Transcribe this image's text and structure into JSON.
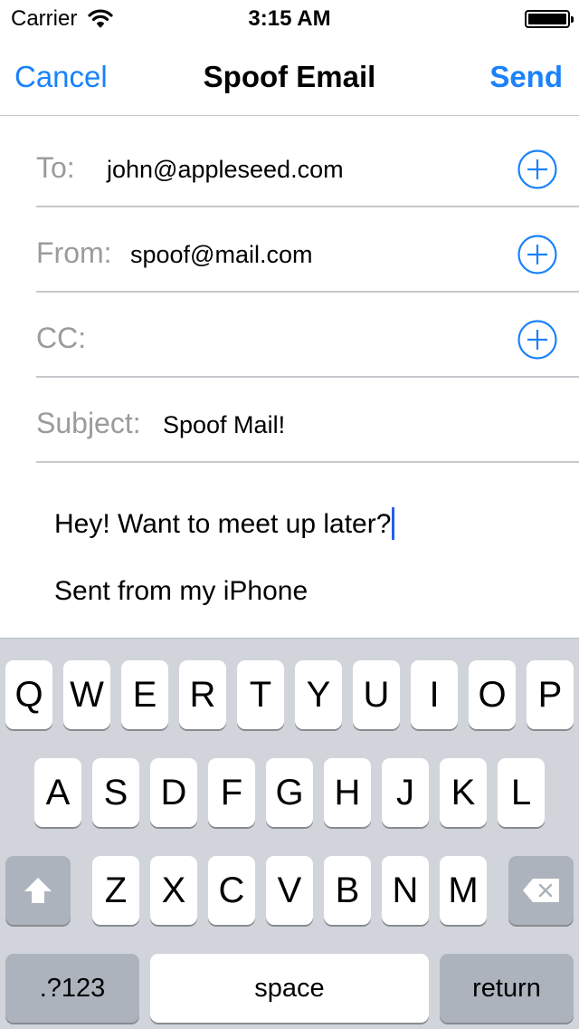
{
  "status_bar": {
    "carrier": "Carrier",
    "time": "3:15 AM"
  },
  "nav": {
    "cancel_label": "Cancel",
    "title": "Spoof Email",
    "send_label": "Send"
  },
  "fields": {
    "to": {
      "label": "To:",
      "value": "john@appleseed.com"
    },
    "from": {
      "label": "From:",
      "value": "spoof@mail.com"
    },
    "cc": {
      "label": "CC:",
      "value": ""
    },
    "subject": {
      "label": "Subject:",
      "value": "Spoof Mail!"
    }
  },
  "body": {
    "message": "Hey! Want to meet up later?",
    "signature": "Sent from my iPhone"
  },
  "keyboard": {
    "row1": [
      "Q",
      "W",
      "E",
      "R",
      "T",
      "Y",
      "U",
      "I",
      "O",
      "P"
    ],
    "row2": [
      "A",
      "S",
      "D",
      "F",
      "G",
      "H",
      "J",
      "K",
      "L"
    ],
    "row3": [
      "Z",
      "X",
      "C",
      "V",
      "B",
      "N",
      "M"
    ],
    "numbers_label": ".?123",
    "space_label": "space",
    "return_label": "return"
  },
  "colors": {
    "accent": "#1a82fb",
    "separator": "#c8c7cc",
    "keyboard_bg": "#d1d5db",
    "special_key": "#acb3bc"
  },
  "icons": {
    "signal": "wifi-icon",
    "battery": "battery-icon",
    "add": "plus-circle-icon",
    "shift": "shift-icon",
    "delete": "backspace-icon"
  }
}
